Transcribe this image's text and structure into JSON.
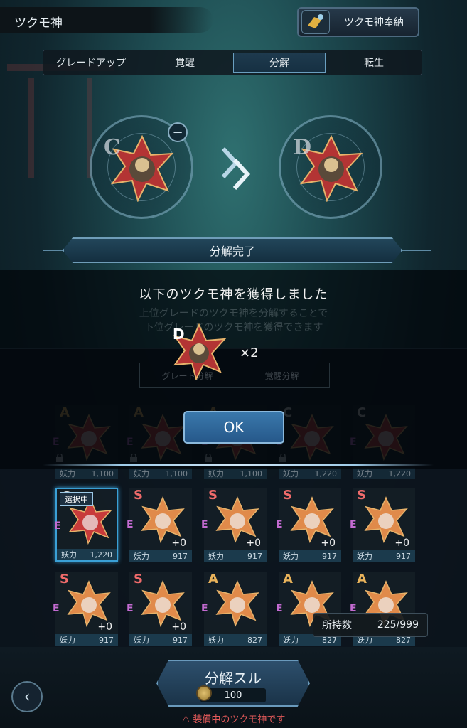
{
  "header": {
    "title": "ツクモ神",
    "offer_label": "ツクモ神奉納"
  },
  "tabs": [
    {
      "label": "グレードアップ",
      "active": false
    },
    {
      "label": "覚醒",
      "active": false
    },
    {
      "label": "分解",
      "active": true
    },
    {
      "label": "転生",
      "active": false
    }
  ],
  "source_slot": {
    "grade": "C",
    "remove": "−"
  },
  "target_slot": {
    "grade": "D"
  },
  "banner": {
    "label": "分解完了"
  },
  "result": {
    "message": "以下のツクモ神を獲得しました",
    "background_text_1": "上位グレードのツクモ神を分解することで",
    "background_text_2": "下位グレードのツクモ神を獲得できます",
    "reward_grade": "D",
    "reward_count": "×2",
    "ok_label": "OK"
  },
  "sub_tabs": [
    "グレード分解",
    "覚醒分解"
  ],
  "colors": {
    "accent": "#3aa0d6",
    "warning": "#e35a5a",
    "star_red": "#c83b3b",
    "star_orange": "#e08a4a"
  },
  "cards": [
    {
      "grade": "A",
      "element": "E",
      "stat_label": "妖力",
      "stat_value": "1,100",
      "plus": "",
      "locked": true,
      "selected": false,
      "star": "red"
    },
    {
      "grade": "A",
      "element": "E",
      "stat_label": "妖力",
      "stat_value": "1,100",
      "plus": "",
      "locked": true,
      "selected": false,
      "star": "red"
    },
    {
      "grade": "A",
      "element": "E",
      "stat_label": "妖力",
      "stat_value": "1,100",
      "plus": "",
      "locked": true,
      "selected": false,
      "star": "red"
    },
    {
      "grade": "C",
      "element": "E",
      "stat_label": "妖力",
      "stat_value": "1,220",
      "plus": "",
      "locked": true,
      "selected": false,
      "star": "red"
    },
    {
      "grade": "C",
      "element": "E",
      "stat_label": "妖力",
      "stat_value": "1,220",
      "plus": "",
      "locked": false,
      "selected": false,
      "star": "red"
    },
    {
      "grade": "C",
      "element": "E",
      "stat_label": "妖力",
      "stat_value": "1,220",
      "plus": "",
      "locked": false,
      "selected": true,
      "badge": "選択中",
      "star": "red"
    },
    {
      "grade": "S",
      "element": "E",
      "stat_label": "妖力",
      "stat_value": "917",
      "plus": "+0",
      "locked": false,
      "selected": false,
      "star": "orange"
    },
    {
      "grade": "S",
      "element": "E",
      "stat_label": "妖力",
      "stat_value": "917",
      "plus": "+0",
      "locked": false,
      "selected": false,
      "star": "orange"
    },
    {
      "grade": "S",
      "element": "E",
      "stat_label": "妖力",
      "stat_value": "917",
      "plus": "+0",
      "locked": false,
      "selected": false,
      "star": "orange"
    },
    {
      "grade": "S",
      "element": "E",
      "stat_label": "妖力",
      "stat_value": "917",
      "plus": "+0",
      "locked": false,
      "selected": false,
      "star": "orange"
    },
    {
      "grade": "S",
      "element": "E",
      "stat_label": "妖力",
      "stat_value": "917",
      "plus": "+0",
      "locked": false,
      "selected": false,
      "star": "orange"
    },
    {
      "grade": "S",
      "element": "E",
      "stat_label": "妖力",
      "stat_value": "917",
      "plus": "+0",
      "locked": false,
      "selected": false,
      "star": "orange"
    },
    {
      "grade": "A",
      "element": "E",
      "stat_label": "妖力",
      "stat_value": "827",
      "plus": "",
      "locked": false,
      "selected": false,
      "star": "orange"
    },
    {
      "grade": "A",
      "element": "E",
      "stat_label": "妖力",
      "stat_value": "827",
      "plus": "",
      "locked": false,
      "selected": false,
      "star": "orange"
    },
    {
      "grade": "A",
      "element": "E",
      "stat_label": "妖力",
      "stat_value": "827",
      "plus": "",
      "locked": false,
      "selected": false,
      "star": "orange"
    }
  ],
  "inventory": {
    "label": "所持数",
    "value": "225/999"
  },
  "footer": {
    "decompose_label": "分解スル",
    "cost": "100",
    "warning": "⚠ 装備中のツクモ神です",
    "back_icon": "‹"
  }
}
